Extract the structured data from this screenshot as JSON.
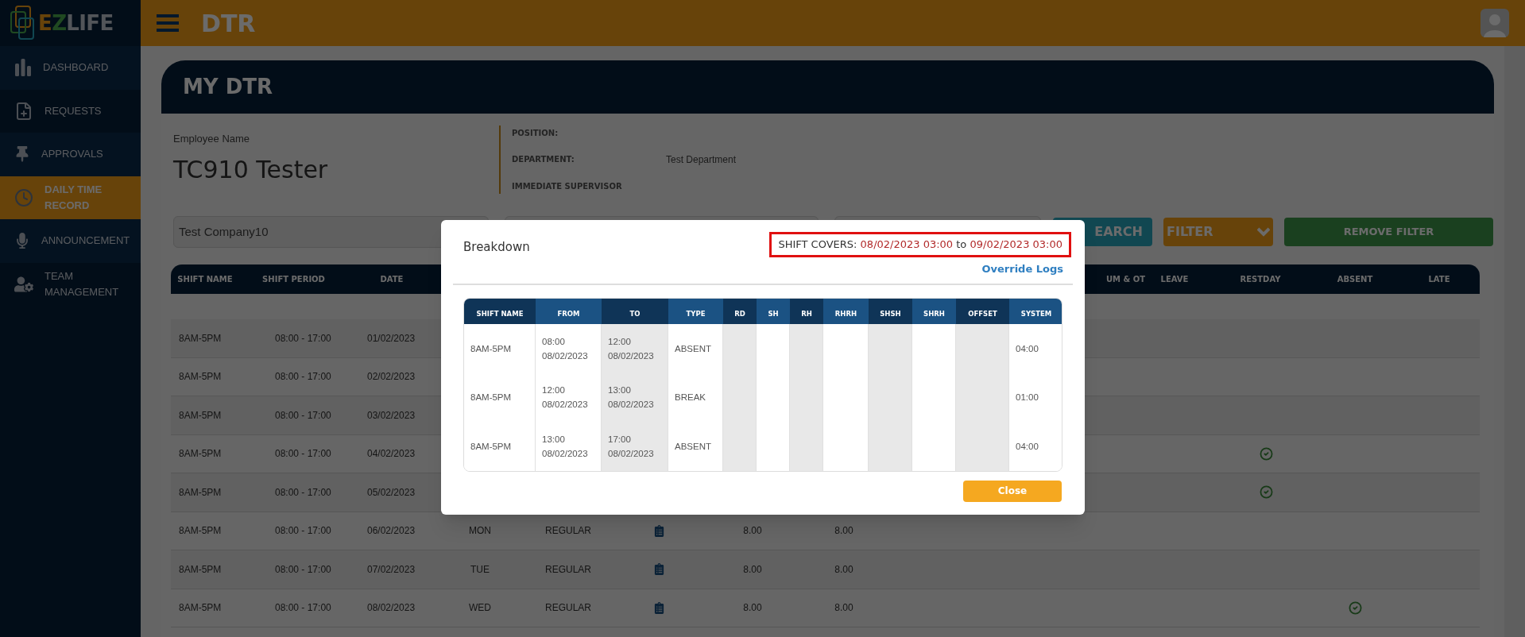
{
  "sidebar": {
    "logo_parts": [
      "E",
      "Z",
      "LIFE"
    ],
    "items": [
      {
        "label": "DASHBOARD",
        "kind": "chart",
        "selected": false
      },
      {
        "label": "REQUESTS",
        "kind": "file",
        "selected": false
      },
      {
        "label": "APPROVALS",
        "kind": "pin",
        "selected": false
      },
      {
        "label": "DAILY TIME RECORD",
        "kind": "clock",
        "selected": true
      },
      {
        "label": "ANNOUNCEMENT",
        "kind": "mic",
        "selected": false
      },
      {
        "label": "TEAM MANAGEMENT",
        "kind": "team",
        "selected": false
      }
    ]
  },
  "header": {
    "title": "DTR"
  },
  "card": {
    "title": "MY DTR",
    "employee": {
      "label": "Employee Name",
      "name": "TC910 Tester"
    },
    "details": [
      {
        "label": "POSITION:"
      },
      {
        "label": "DEPARTMENT:",
        "value": "Test Department"
      },
      {
        "label": "IMMEDIATE SUPERVISOR"
      }
    ],
    "filters": {
      "company": "Test Company10",
      "search_button": "EARCH",
      "filter_button": "FILTER",
      "remove_filter_button": "REMOVE FILTER"
    }
  },
  "table": {
    "columns_left": [
      "SHIFT NAME",
      "SHIFT PERIOD",
      "DATE"
    ],
    "columns_right": [
      "UM & OT",
      "LEAVE",
      "RESTDAY",
      "ABSENT",
      "LATE"
    ],
    "rows": [
      {
        "shift_name": "8AM-5PM",
        "shift_period": "08:00 - 17:00",
        "date": "01/02/2023",
        "restday": false,
        "absent": false
      },
      {
        "shift_name": "8AM-5PM",
        "shift_period": "08:00 - 17:00",
        "date": "02/02/2023",
        "restday": false,
        "absent": false
      },
      {
        "shift_name": "8AM-5PM",
        "shift_period": "08:00 - 17:00",
        "date": "03/02/2023",
        "restday": false,
        "absent": false
      },
      {
        "shift_name": "8AM-5PM",
        "shift_period": "08:00 - 17:00",
        "date": "04/02/2023",
        "restday": true,
        "absent": false
      },
      {
        "shift_name": "8AM-5PM",
        "shift_period": "08:00 - 17:00",
        "date": "05/02/2023",
        "restday": true,
        "absent": false
      },
      {
        "shift_name": "8AM-5PM",
        "shift_period": "08:00 - 17:00",
        "date": "06/02/2023",
        "day": "MON",
        "type": "REGULAR",
        "details": true,
        "column_7": "8.00",
        "column_8": "8.00",
        "restday": false,
        "absent": false
      },
      {
        "shift_name": "8AM-5PM",
        "shift_period": "08:00 - 17:00",
        "date": "07/02/2023",
        "day": "TUE",
        "type": "REGULAR",
        "details": true,
        "column_7": "8.00",
        "column_8": "8.00",
        "restday": false,
        "absent": false
      },
      {
        "shift_name": "8AM-5PM",
        "shift_period": "08:00 - 17:00",
        "date": "08/02/2023",
        "day": "WED",
        "type": "REGULAR",
        "details": true,
        "column_7": "8.00",
        "column_8": "8.00",
        "restday": false,
        "absent": true
      }
    ]
  },
  "modal": {
    "title": "Breakdown",
    "shift_covers": {
      "label": "SHIFT COVERS:",
      "start": "08/02/2023 03:00",
      "joiner": "to",
      "end": "09/02/2023 03:00"
    },
    "override_link": "Override Logs",
    "columns": [
      "SHIFT NAME",
      "FROM",
      "TO",
      "TYPE",
      "RD",
      "SH",
      "RH",
      "RHRH",
      "SHSH",
      "SHRH",
      "OFFSET",
      "SYSTEM"
    ],
    "rows": [
      {
        "shift_name": "8AM-5PM",
        "from": "08:00\n08/02/2023",
        "to": "12:00\n08/02/2023",
        "type": "ABSENT",
        "system": "04:00"
      },
      {
        "shift_name": "8AM-5PM",
        "from": "12:00\n08/02/2023",
        "to": "13:00\n08/02/2023",
        "type": "BREAK",
        "system": "01:00"
      },
      {
        "shift_name": "8AM-5PM",
        "from": "13:00\n08/02/2023",
        "to": "17:00\n08/02/2023",
        "type": "ABSENT",
        "system": "04:00"
      }
    ],
    "close_button": "Close"
  }
}
